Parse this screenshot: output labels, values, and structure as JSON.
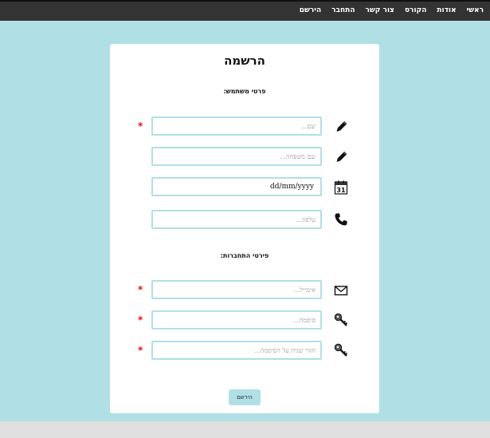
{
  "nav": {
    "items": [
      "ראשי",
      "אודות",
      "הקורס",
      "צור קשר",
      "התחבר",
      "הירשם"
    ]
  },
  "form": {
    "title": "הרשמה",
    "user_section": "פרטי משתמש:",
    "login_section": "פירטי התחברות:",
    "first_name_placeholder": "שם...",
    "last_name_placeholder": "שם משפחה...",
    "birthdate_value": "dd/mm/yyyy",
    "phone_placeholder": "טלפון...",
    "email_placeholder": "אימייל...",
    "password_placeholder": "סיסמה...",
    "password_repeat_placeholder": "חזור שנית על הסיסמה...",
    "required_mark": "*",
    "calendar_day": "31",
    "submit_label": "הירשם"
  },
  "colors": {
    "accent": "#b0e0e6",
    "nav_bg": "#333333",
    "required": "#e01010"
  },
  "icons": [
    "pencil-icon",
    "pencil-icon",
    "calendar-icon",
    "phone-icon",
    "envelope-icon",
    "key-icon",
    "key-icon"
  ]
}
